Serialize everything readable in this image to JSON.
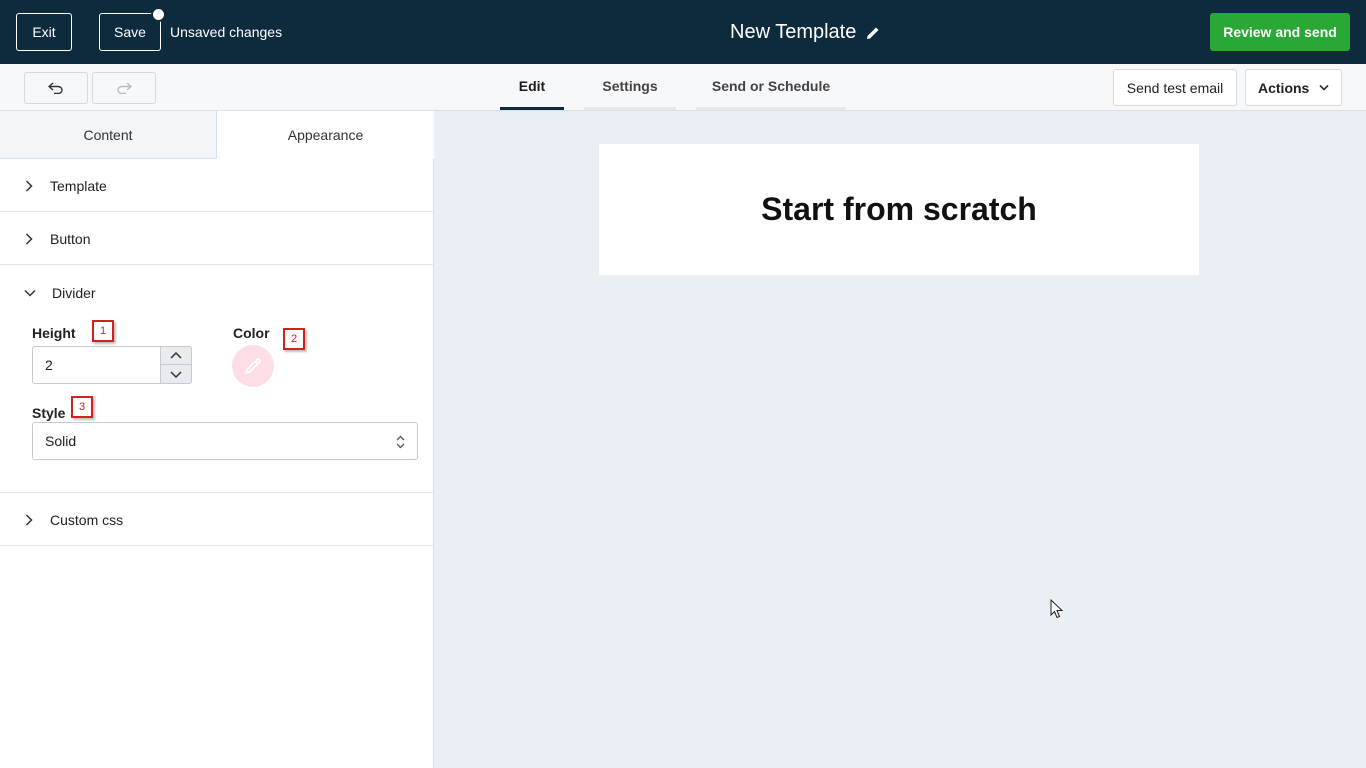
{
  "header": {
    "exit_label": "Exit",
    "save_label": "Save",
    "unsaved_text": "Unsaved changes",
    "title": "New Template",
    "review_label": "Review and send"
  },
  "toolbar": {
    "tabs": [
      "Edit",
      "Settings",
      "Send or Schedule"
    ],
    "active_tab": "Edit",
    "test_email_label": "Send test email",
    "actions_label": "Actions"
  },
  "panel": {
    "tabs": [
      "Content",
      "Appearance"
    ],
    "active_tab": "Appearance",
    "sections": {
      "template": "Template",
      "button": "Button",
      "divider": "Divider",
      "custom_css": "Custom css"
    },
    "divider": {
      "height_label": "Height",
      "height_value": "2",
      "color_label": "Color",
      "color_value": "#fddde6",
      "style_label": "Style",
      "style_value": "Solid"
    }
  },
  "markers": [
    "1",
    "2",
    "3"
  ],
  "canvas": {
    "heading": "Start from scratch"
  },
  "colors": {
    "topbar": "#0e2a3d",
    "accent_green": "#2aa836",
    "canvas_bg": "#eaeef5"
  }
}
